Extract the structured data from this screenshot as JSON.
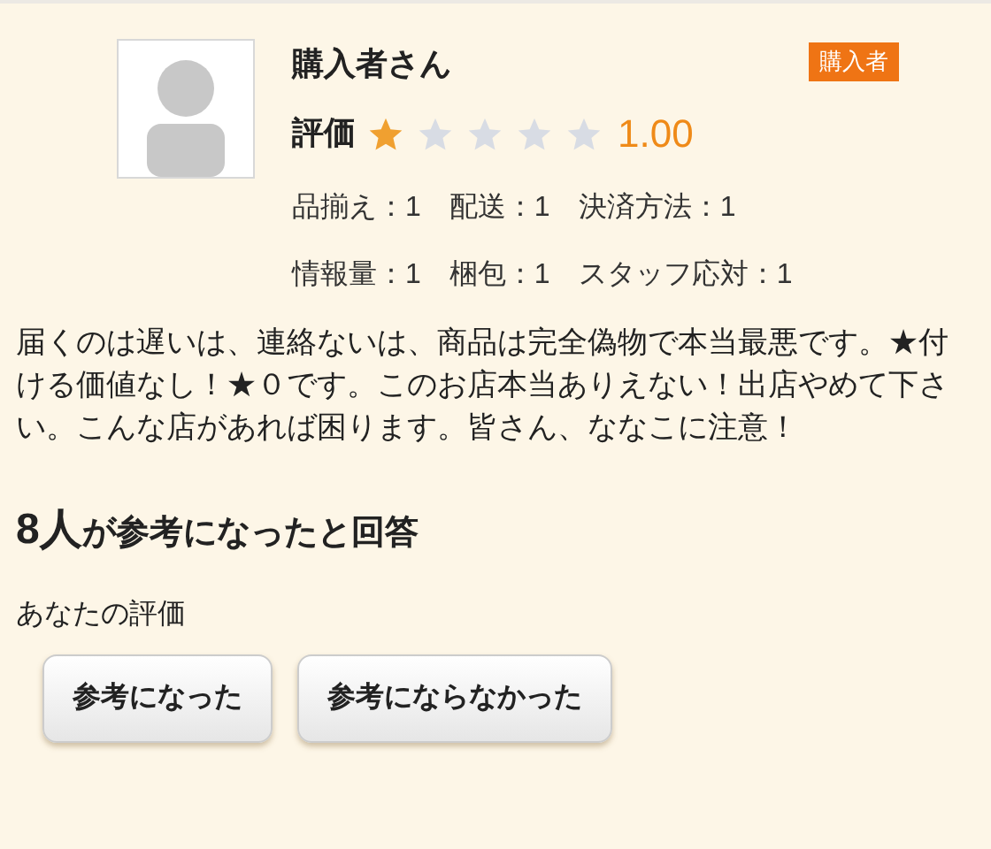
{
  "review": {
    "reviewer": "購入者さん",
    "badge": "購入者",
    "rating_label": "評価",
    "stars": 1,
    "score": "1.00",
    "criteria": [
      [
        "品揃え：1",
        "配送：1",
        "決済方法：1"
      ],
      [
        "情報量：1",
        "梱包：1",
        "スタッフ応対：1"
      ]
    ],
    "body": "届くのは遅いは、連絡ないは、商品は完全偽物で本当最悪です。★付ける価値なし！★０です。このお店本当ありえない！出店やめて下さい。こんな店があれば困ります。皆さん、ななこに注意！"
  },
  "helpful": {
    "count": "8人",
    "text": "が参考になったと回答"
  },
  "your_rating": {
    "label": "あなたの評価",
    "buttons": [
      "参考になった",
      "参考にならなかった"
    ]
  }
}
